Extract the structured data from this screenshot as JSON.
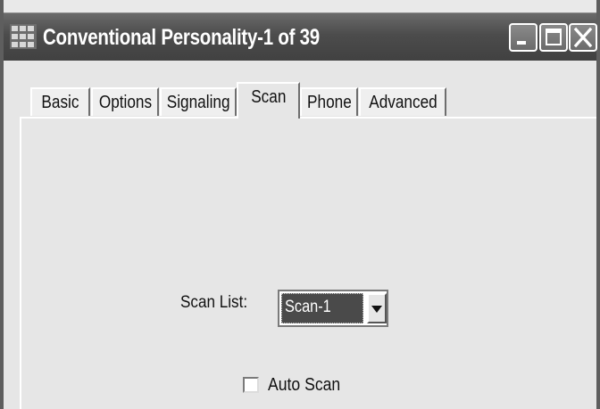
{
  "window": {
    "title": "Conventional Personality-1 of 39",
    "icons": {
      "app": "app-grid-icon",
      "minimize": "minimize-icon",
      "maximize": "maximize-icon",
      "close": "close-icon"
    }
  },
  "tabs": [
    {
      "label": "Basic",
      "active": false
    },
    {
      "label": "Options",
      "active": false
    },
    {
      "label": "Signaling",
      "active": false
    },
    {
      "label": "Scan",
      "active": true
    },
    {
      "label": "Phone",
      "active": false
    },
    {
      "label": "Advanced",
      "active": false
    }
  ],
  "scan": {
    "scan_list_label": "Scan List:",
    "scan_list_value": "Scan-1",
    "auto_scan_label": "Auto Scan",
    "auto_scan_checked": false
  },
  "colors": {
    "title_bar": "#4c4c4c",
    "title_text": "#ffffff",
    "selected_value_bg": "#4a4a4a"
  }
}
